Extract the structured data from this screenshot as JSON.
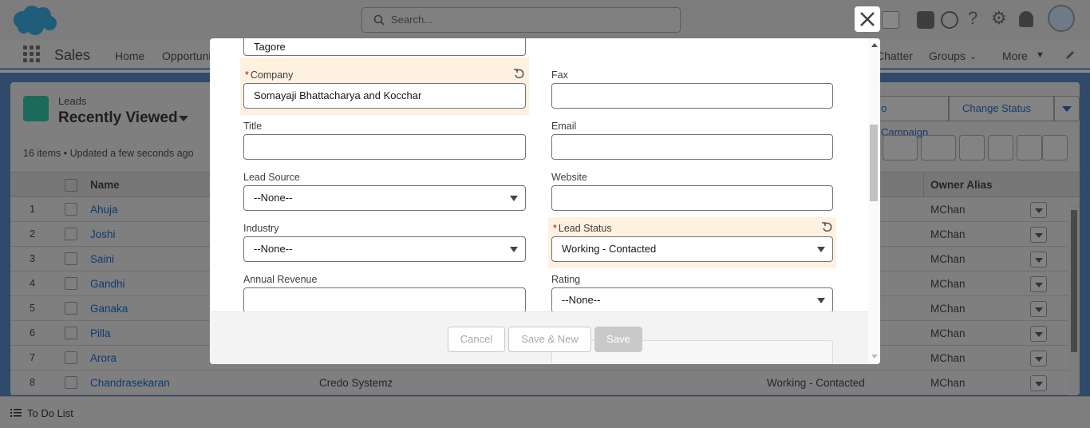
{
  "header": {
    "search_placeholder": "Search...",
    "app_name": "Sales",
    "nav_items": [
      "Home",
      "Opportuni",
      "Chatter",
      "Groups",
      "More"
    ]
  },
  "list": {
    "object_label": "Leads",
    "view_name": "Recently Viewed",
    "meta": "16 items • Updated a few seconds ago",
    "actions": [
      "o Campaign",
      "Change Status"
    ],
    "columns": {
      "name": "Name",
      "owner": "Owner Alias"
    },
    "rows": [
      {
        "num": "1",
        "name": "Ahuja",
        "company": "",
        "status": "",
        "owner": "MChan"
      },
      {
        "num": "2",
        "name": "Joshi",
        "company": "",
        "status": "",
        "owner": "MChan"
      },
      {
        "num": "3",
        "name": "Saini",
        "company": "",
        "status": "",
        "owner": "MChan"
      },
      {
        "num": "4",
        "name": "Gandhi",
        "company": "",
        "status": "",
        "owner": "MChan"
      },
      {
        "num": "5",
        "name": "Ganaka",
        "company": "",
        "status": "",
        "owner": "MChan"
      },
      {
        "num": "6",
        "name": "Pilla",
        "company": "",
        "status": "",
        "owner": "MChan"
      },
      {
        "num": "7",
        "name": "Arora",
        "company": "",
        "status": "",
        "owner": "MChan"
      },
      {
        "num": "8",
        "name": "Chandrasekaran",
        "company": "Credo Systemz",
        "status": "Working - Contacted",
        "owner": "MChan"
      }
    ]
  },
  "footer": {
    "todo_label": "To Do List"
  },
  "modal": {
    "last_name_value": "Tagore",
    "company": {
      "label": "Company",
      "value": "Somayaji Bhattacharya and Kocchar"
    },
    "fax": {
      "label": "Fax",
      "value": ""
    },
    "title": {
      "label": "Title",
      "value": ""
    },
    "email": {
      "label": "Email",
      "value": ""
    },
    "lead_source": {
      "label": "Lead Source",
      "value": "--None--"
    },
    "website": {
      "label": "Website",
      "value": ""
    },
    "industry": {
      "label": "Industry",
      "value": "--None--"
    },
    "lead_status": {
      "label": "Lead Status",
      "value": "Working - Contacted"
    },
    "annual_revenue": {
      "label": "Annual Revenue",
      "value": ""
    },
    "rating": {
      "label": "Rating",
      "value": "--None--"
    },
    "required_mark": "*",
    "buttons": {
      "cancel": "Cancel",
      "save_new": "Save & New",
      "save": "Save"
    }
  },
  "colors": {
    "brand": "#00a1e0",
    "edited_highlight": "#fef1e0",
    "required": "#ba0517",
    "link": "#0d3a74"
  }
}
